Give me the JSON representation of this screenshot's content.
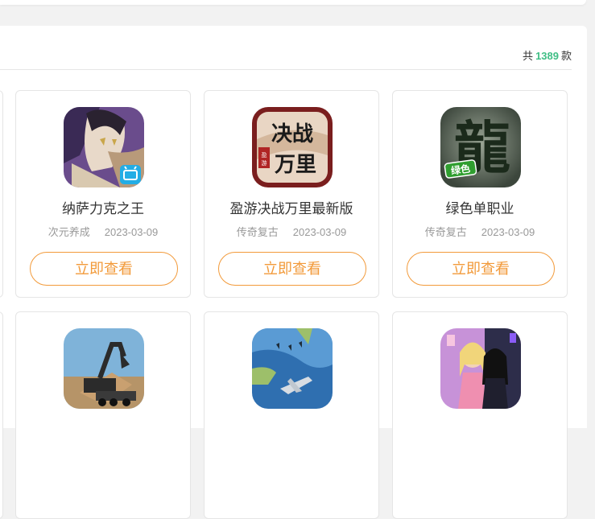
{
  "summary": {
    "prefix": "共",
    "count": "1389",
    "suffix": "款"
  },
  "games": [
    {
      "title": "纳萨力克之王",
      "category": "次元养成",
      "date": "2023-03-09",
      "button": "立即查看",
      "icon": "anime-character-icon"
    },
    {
      "title": "盈游决战万里最新版",
      "category": "传奇复古",
      "date": "2023-03-09",
      "button": "立即查看",
      "icon": "juezhan-wanli-icon",
      "icon_text": [
        "决战",
        "万里"
      ],
      "icon_badge": "盈游"
    },
    {
      "title": "绿色单职业",
      "category": "传奇复古",
      "date": "2023-03-09",
      "button": "立即查看",
      "icon": "dragon-character-icon",
      "icon_text": [
        "龍"
      ],
      "icon_badge": "绿色"
    },
    {
      "icon": "excavator-icon"
    },
    {
      "icon": "fighter-jet-icon"
    },
    {
      "icon": "dress-up-girls-icon"
    }
  ],
  "colors": {
    "accent": "#f29a3a",
    "count": "#3fbe85"
  }
}
